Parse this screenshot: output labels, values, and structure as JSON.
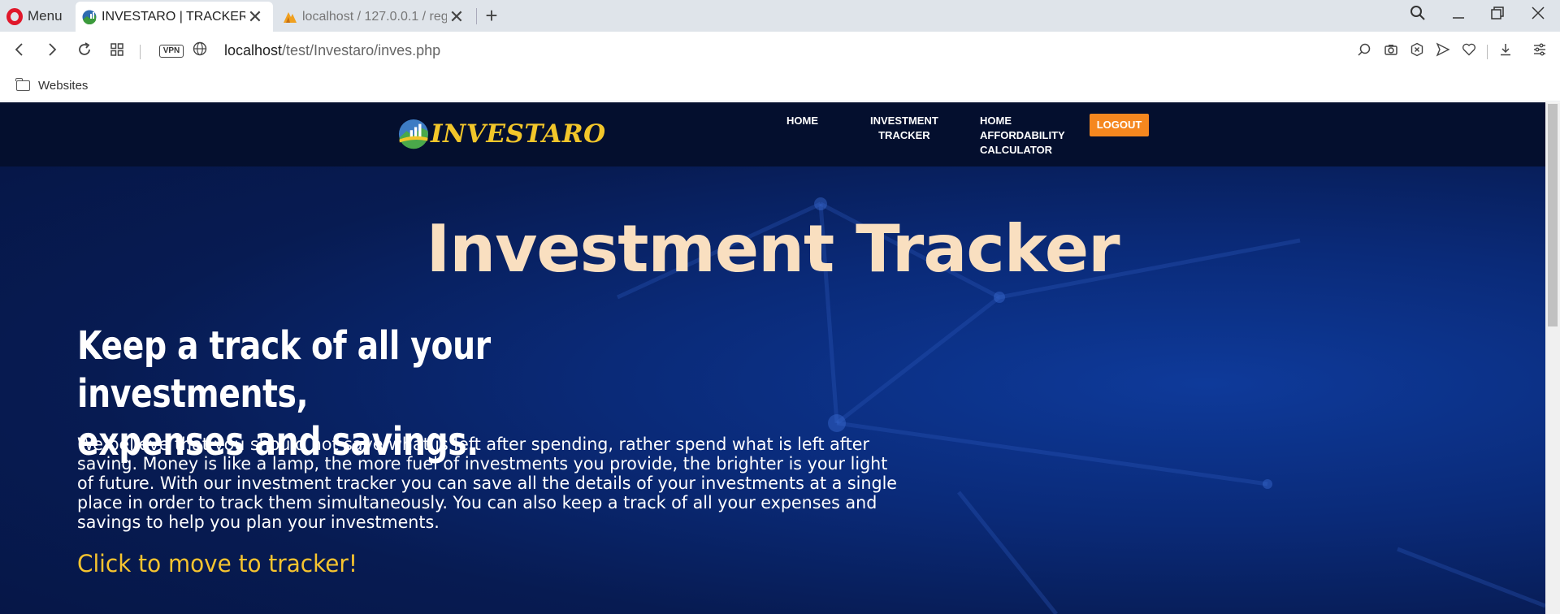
{
  "browser": {
    "menu_label": "Menu",
    "tabs": [
      {
        "title": "INVESTARO | TRACKER",
        "active": true
      },
      {
        "title": "localhost / 127.0.0.1 / regis",
        "active": false
      }
    ],
    "address": {
      "host": "localhost",
      "path": "/test/Investaro/inves.php"
    },
    "vpn_label": "VPN",
    "bookmarks": [
      {
        "label": "Websites"
      }
    ]
  },
  "site": {
    "logo_text": "INVESTARO",
    "nav": {
      "home": "HOME",
      "tracker_line1": "INVESTMENT",
      "tracker_line2": "TRACKER",
      "afford_line1": "HOME",
      "afford_line2": "AFFORDABILITY",
      "afford_line3": "CALCULATOR",
      "logout": "LOGOUT"
    }
  },
  "hero": {
    "title": "Investment Tracker",
    "headline_line1": "Keep a track of all your investments,",
    "headline_line2": "expenses and savings.",
    "body": "We believe that you should not save what is left after spending, rather spend what is left after saving. Money is like a lamp, the more fuel of investments you provide, the brighter is your light of future. With our investment tracker you can save all the details of your investments at a single place in order to track them simultaneously. You can also keep a track of all your expenses and savings to help you plan your investments.",
    "cta": "Click to move to tracker!"
  },
  "colors": {
    "nav_bg": "#040f2e",
    "logout_bg": "#f5871f",
    "title_color": "#f9dfc0",
    "cta_color": "#f6c42f",
    "logo_color": "#f2c62a"
  }
}
